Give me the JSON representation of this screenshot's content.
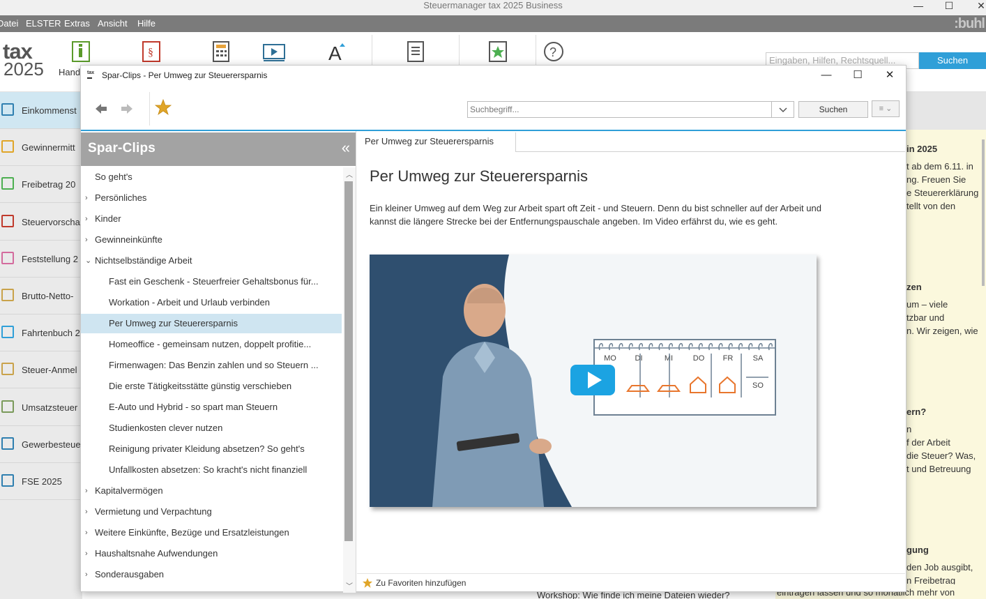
{
  "app": {
    "title": "Steuermanager tax 2025 Business",
    "brand": ":buhl",
    "logo_word": "tax",
    "logo_year": "2025"
  },
  "menubar": {
    "items": [
      "Datei",
      "ELSTER",
      "Extras",
      "Ansicht",
      "Hilfe"
    ]
  },
  "toolbar": {
    "first_label": "Hand",
    "search_placeholder": "Eingaben, Hilfen, Rechtsquell...",
    "search_button": "Suchen"
  },
  "left_nav": {
    "items": [
      {
        "label": "Einkommenst",
        "icon": "income-tax-icon"
      },
      {
        "label": "Gewinnermitt",
        "icon": "profit-chart-icon"
      },
      {
        "label": "Freibetrag 20",
        "icon": "allowance-percent-icon"
      },
      {
        "label": "Steuervorscha",
        "icon": "euro-document-icon"
      },
      {
        "label": "Feststellung 2",
        "icon": "people-icon"
      },
      {
        "label": "Brutto-Netto-",
        "icon": "money-stack-icon"
      },
      {
        "label": "Fahrtenbuch 2",
        "icon": "map-pin-icon"
      },
      {
        "label": "Steuer-Anmel",
        "icon": "envelope-icon"
      },
      {
        "label": "Umsatzsteuer",
        "icon": "vat-chart-icon"
      },
      {
        "label": "Gewerbesteue",
        "icon": "shop-icon"
      },
      {
        "label": "FSE 2025",
        "icon": "checklist-icon"
      }
    ]
  },
  "background_panel": {
    "lines": [
      {
        "text": "in 2025",
        "bold": true
      },
      {
        "text": "t ab dem 6.11. in",
        "bold": false
      },
      {
        "text": "ng. Freuen Sie",
        "bold": false
      },
      {
        "text": "e Steuererklärung",
        "bold": false
      },
      {
        "text": "tellt von den",
        "bold": false
      },
      {
        "text": "zen",
        "bold": true
      },
      {
        "text": "um – viele",
        "bold": false
      },
      {
        "text": "tzbar und",
        "bold": false
      },
      {
        "text": "n. Wir zeigen, wie",
        "bold": false
      },
      {
        "text": "ern?",
        "bold": true
      },
      {
        "text": "n",
        "bold": false
      },
      {
        "text": "f der Arbeit",
        "bold": false
      },
      {
        "text": "die Steuer? Was,",
        "bold": false
      },
      {
        "text": "t und Betreuung",
        "bold": false
      },
      {
        "text": "gung",
        "bold": true
      },
      {
        "text": "den Job ausgibt,",
        "bold": false
      },
      {
        "text": "n Freibetrag",
        "bold": false
      }
    ],
    "bottom_text": "eintragen lassen und so monatlich mehr von",
    "bottom_mid_text": "Workshop: Wie finde ich meine Dateien wieder?"
  },
  "dialog": {
    "title": "Spar-Clips - Per Umweg zur Steuerersparnis",
    "search_placeholder": "Suchbegriff...",
    "search_button": "Suchen",
    "panel_title": "Spar-Clips",
    "tree": [
      {
        "label": "So geht's",
        "level": 0,
        "chevron": "",
        "selected": false
      },
      {
        "label": "Persönliches",
        "level": 0,
        "chevron": "›",
        "selected": false
      },
      {
        "label": "Kinder",
        "level": 0,
        "chevron": "›",
        "selected": false
      },
      {
        "label": "Gewinneinkünfte",
        "level": 0,
        "chevron": "›",
        "selected": false
      },
      {
        "label": "Nichtselbständige Arbeit",
        "level": 0,
        "chevron": "⌄",
        "selected": false
      },
      {
        "label": "Fast ein Geschenk - Steuerfreier Gehaltsbonus für...",
        "level": 1,
        "chevron": "",
        "selected": false
      },
      {
        "label": "Workation - Arbeit und Urlaub verbinden",
        "level": 1,
        "chevron": "",
        "selected": false
      },
      {
        "label": "Per Umweg zur Steuerersparnis",
        "level": 1,
        "chevron": "",
        "selected": true
      },
      {
        "label": "Homeoffice - gemeinsam nutzen, doppelt profitie...",
        "level": 1,
        "chevron": "",
        "selected": false
      },
      {
        "label": "Firmenwagen: Das Benzin zahlen und so Steuern ...",
        "level": 1,
        "chevron": "",
        "selected": false
      },
      {
        "label": "Die erste Tätigkeitsstätte günstig verschieben",
        "level": 1,
        "chevron": "",
        "selected": false
      },
      {
        "label": "E-Auto und Hybrid - so spart man Steuern",
        "level": 1,
        "chevron": "",
        "selected": false
      },
      {
        "label": "Studienkosten clever nutzen",
        "level": 1,
        "chevron": "",
        "selected": false
      },
      {
        "label": "Reinigung privater Kleidung absetzen? So geht's",
        "level": 1,
        "chevron": "",
        "selected": false
      },
      {
        "label": "Unfallkosten absetzen: So kracht's nicht finanziell",
        "level": 1,
        "chevron": "",
        "selected": false
      },
      {
        "label": "Kapitalvermögen",
        "level": 0,
        "chevron": "›",
        "selected": false
      },
      {
        "label": "Vermietung und Verpachtung",
        "level": 0,
        "chevron": "›",
        "selected": false
      },
      {
        "label": "Weitere Einkünfte, Bezüge und Ersatzleistungen",
        "level": 0,
        "chevron": "›",
        "selected": false
      },
      {
        "label": "Haushaltsnahe Aufwendungen",
        "level": 0,
        "chevron": "›",
        "selected": false
      },
      {
        "label": "Sonderausgaben",
        "level": 0,
        "chevron": "›",
        "selected": false
      }
    ],
    "tab_label": "Per Umweg zur Steuerersparnis",
    "content_title": "Per Umweg zur Steuerersparnis",
    "content_text": "Ein kleiner Umweg auf dem Weg zur Arbeit spart oft Zeit - und Steuern. Denn du bist schneller auf der Arbeit und kannst die längere Strecke bei der Entfernungspauschale angeben. Im Video erfährst du, wie es geht.",
    "video_days": [
      "MO",
      "DI",
      "MI",
      "DO",
      "FR",
      "SA",
      "SO"
    ],
    "favorites_label": "Zu Favoriten hinzufügen"
  },
  "colors": {
    "accent": "#2f9fd8",
    "selection": "#cfe5f1",
    "panel_header": "#a3a3a3",
    "calendar_orange": "#e8762d"
  }
}
